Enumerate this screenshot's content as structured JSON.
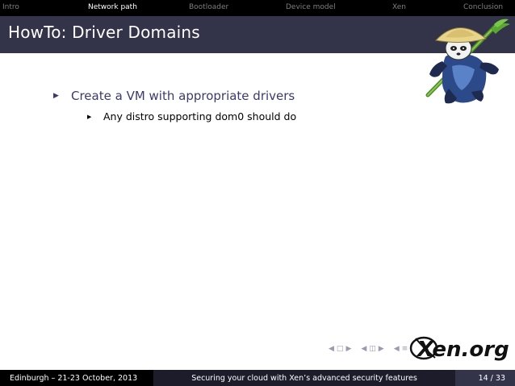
{
  "nav": {
    "items": [
      {
        "label": "Intro",
        "active": false
      },
      {
        "label": "Network path",
        "active": true
      },
      {
        "label": "Bootloader",
        "active": false
      },
      {
        "label": "Device model",
        "active": false
      },
      {
        "label": "Xen",
        "active": false
      },
      {
        "label": "Conclusion",
        "active": false
      }
    ]
  },
  "slide": {
    "title": "HowTo: Driver Domains",
    "bullets": [
      {
        "text": "Create a VM with appropriate drivers",
        "sub": [
          "Any distro supporting dom0 should do"
        ]
      }
    ]
  },
  "logo": {
    "text": "Xen.org"
  },
  "footer": {
    "left": "Edinburgh – 21-23 October, 2013",
    "center": "Securing your cloud with Xen’s advanced security features",
    "page": "14 / 33"
  },
  "colors": {
    "title_bg": "#33334a",
    "nav_bg": "#000000",
    "accent": "#3a3a6e"
  }
}
